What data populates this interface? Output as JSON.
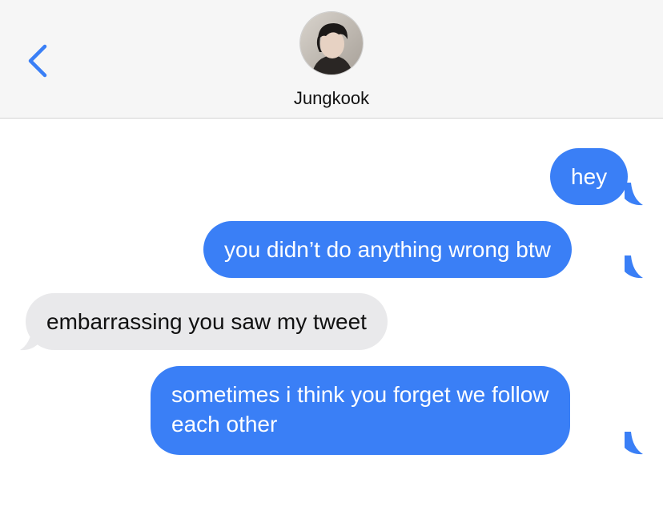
{
  "header": {
    "contact_name": "Jungkook",
    "back_icon": "chevron-left-icon",
    "avatar": "contact-avatar"
  },
  "colors": {
    "accent": "#3a7ff6",
    "sent_bubble": "#3a7ff6",
    "received_bubble": "#e9e9eb",
    "header_bg": "#f6f6f6"
  },
  "messages": [
    {
      "direction": "sent",
      "text": "hey"
    },
    {
      "direction": "sent",
      "text": "you didn’t do anything wrong btw"
    },
    {
      "direction": "received",
      "text": "embarrassing you saw my tweet"
    },
    {
      "direction": "sent",
      "lines": [
        "sometimes i think you forget we follow",
        "each other"
      ]
    }
  ]
}
